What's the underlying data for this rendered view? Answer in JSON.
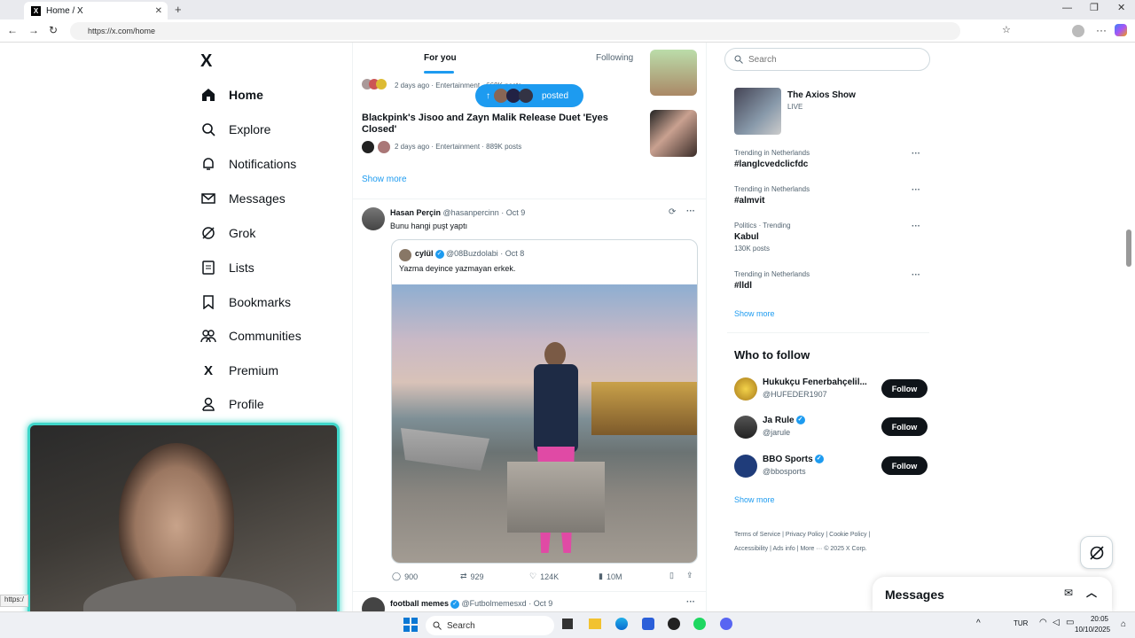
{
  "browser": {
    "tab_title": "Home / X",
    "tab_close": "✕",
    "new_tab": "+",
    "url": "https://x.com/home"
  },
  "nav": {
    "logo": "X",
    "items": [
      {
        "label": "Home",
        "icon": "home-icon"
      },
      {
        "label": "Explore",
        "icon": "search-icon"
      },
      {
        "label": "Notifications",
        "icon": "bell-icon"
      },
      {
        "label": "Messages",
        "icon": "mail-icon"
      },
      {
        "label": "Grok",
        "icon": "grok-icon"
      },
      {
        "label": "Lists",
        "icon": "list-icon"
      },
      {
        "label": "Bookmarks",
        "icon": "bookmark-icon"
      },
      {
        "label": "Communities",
        "icon": "people-icon"
      },
      {
        "label": "Premium",
        "icon": "x-premium-icon"
      },
      {
        "label": "Profile",
        "icon": "person-icon"
      }
    ]
  },
  "feed": {
    "tabs": [
      "For you",
      "Following"
    ],
    "posted_pill": "posted",
    "trends": [
      {
        "meta": "2 days ago · Entertainment · 669K posts"
      },
      {
        "title": "Blackpink's Jisoo and Zayn Malik Release Duet 'Eyes Closed'",
        "meta": "2 days ago · Entertainment · 889K posts"
      }
    ],
    "show_more": "Show more",
    "post": {
      "name": "Hasan Perçin",
      "handle": "@hasanpercinn",
      "date": "· Oct 9",
      "text": "Bunu hangi puşt yaptı",
      "quote": {
        "name": "cylül",
        "handle": "@08Buzdolabi",
        "date": "· Oct 8",
        "text": "Yazma deyince yazmayan erkek."
      },
      "stats": {
        "replies": "900",
        "reposts": "929",
        "likes": "124K",
        "views": "10M"
      }
    },
    "next_post": {
      "name": "football memes",
      "handle": "@Futbolmemesxd",
      "date": "· Oct 9"
    }
  },
  "right": {
    "search_placeholder": "Search",
    "live": {
      "title": "The Axios Show",
      "badge": "LIVE"
    },
    "trends": [
      {
        "context": "Trending in Netherlands",
        "title": "#langlcvedclicfdc",
        "count": ""
      },
      {
        "context": "Trending in Netherlands",
        "title": "#almvit",
        "count": ""
      },
      {
        "context": "Politics · Trending",
        "title": "Kabul",
        "count": "130K posts"
      },
      {
        "context": "Trending in Netherlands",
        "title": "#lldl",
        "count": ""
      }
    ],
    "show_more": "Show more",
    "who_title": "Who to follow",
    "follow": [
      {
        "name": "Hukukçu Fenerbahçelil...",
        "handle": "@HUFEDER1907",
        "btn": "Follow"
      },
      {
        "name": "Ja Rule",
        "handle": "@jarule",
        "btn": "Follow"
      },
      {
        "name": "BBO Sports",
        "handle": "@bbosports",
        "btn": "Follow"
      }
    ],
    "who_more": "Show more",
    "footer": [
      "Terms of Service",
      "Privacy Policy",
      "Cookie Policy",
      "Accessibility",
      "Ads info",
      "More ···",
      "© 2025 X Corp."
    ],
    "messages": "Messages"
  },
  "taskbar": {
    "search": "Search",
    "lang": "TUR",
    "time": "20:05",
    "date": "10/10/2025"
  },
  "status_url": "https:/"
}
